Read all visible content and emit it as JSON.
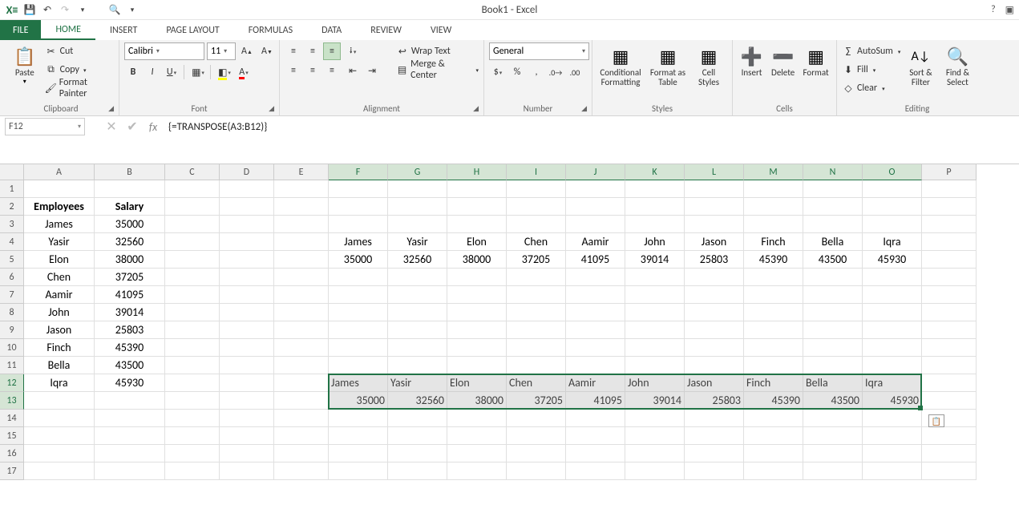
{
  "title": "Book1 - Excel",
  "tabs": {
    "file": "FILE",
    "home": "HOME",
    "insert": "INSERT",
    "pagelayout": "PAGE LAYOUT",
    "formulas": "FORMULAS",
    "data": "DATA",
    "review": "REVIEW",
    "view": "VIEW"
  },
  "clipboard": {
    "paste": "Paste",
    "cut": "Cut",
    "copy": "Copy",
    "formatpainter": "Format Painter",
    "label": "Clipboard"
  },
  "font": {
    "name": "Calibri",
    "size": "11",
    "label": "Font"
  },
  "alignment": {
    "wrap": "Wrap Text",
    "merge": "Merge & Center",
    "label": "Alignment"
  },
  "number": {
    "format": "General",
    "label": "Number"
  },
  "styles": {
    "cond": "Conditional Formatting",
    "table": "Format as Table",
    "cell": "Cell Styles",
    "label": "Styles"
  },
  "cells": {
    "insert": "Insert",
    "delete": "Delete",
    "format": "Format",
    "label": "Cells"
  },
  "editing": {
    "autosum": "AutoSum",
    "fill": "Fill",
    "clear": "Clear",
    "sort": "Sort & Filter",
    "find": "Find & Select",
    "label": "Editing"
  },
  "namebox": "F12",
  "formula": "{=TRANSPOSE(A3:B12)}",
  "headers": {
    "employees": "Employees",
    "salary": "Salary"
  },
  "employees": [
    {
      "name": "James",
      "salary": "35000"
    },
    {
      "name": "Yasir",
      "salary": "32560"
    },
    {
      "name": "Elon",
      "salary": "38000"
    },
    {
      "name": "Chen",
      "salary": "37205"
    },
    {
      "name": "Aamir",
      "salary": "41095"
    },
    {
      "name": "John",
      "salary": "39014"
    },
    {
      "name": "Jason",
      "salary": "25803"
    },
    {
      "name": "Finch",
      "salary": "45390"
    },
    {
      "name": "Bella",
      "salary": "43500"
    },
    {
      "name": "Iqra",
      "salary": "45930"
    }
  ],
  "cols": [
    "A",
    "B",
    "C",
    "D",
    "E",
    "F",
    "G",
    "H",
    "I",
    "J",
    "K",
    "L",
    "M",
    "N",
    "O",
    "P"
  ],
  "rowcount": 17,
  "chart_data": {
    "type": "table",
    "description": "Employee salary list (A2:B12) and its transpose via {=TRANSPOSE(A3:B12)} shown at F4:O5 (centered) and the active array selection F12:O13 (left/right aligned).",
    "columns": [
      "Employees",
      "Salary"
    ],
    "rows": [
      [
        "James",
        35000
      ],
      [
        "Yasir",
        32560
      ],
      [
        "Elon",
        38000
      ],
      [
        "Chen",
        37205
      ],
      [
        "Aamir",
        41095
      ],
      [
        "John",
        39014
      ],
      [
        "Jason",
        25803
      ],
      [
        "Finch",
        45390
      ],
      [
        "Bella",
        43500
      ],
      [
        "Iqra",
        45930
      ]
    ],
    "active_cell": "F12",
    "selected_range": "F12:O13",
    "formula": "{=TRANSPOSE(A3:B12)}"
  }
}
